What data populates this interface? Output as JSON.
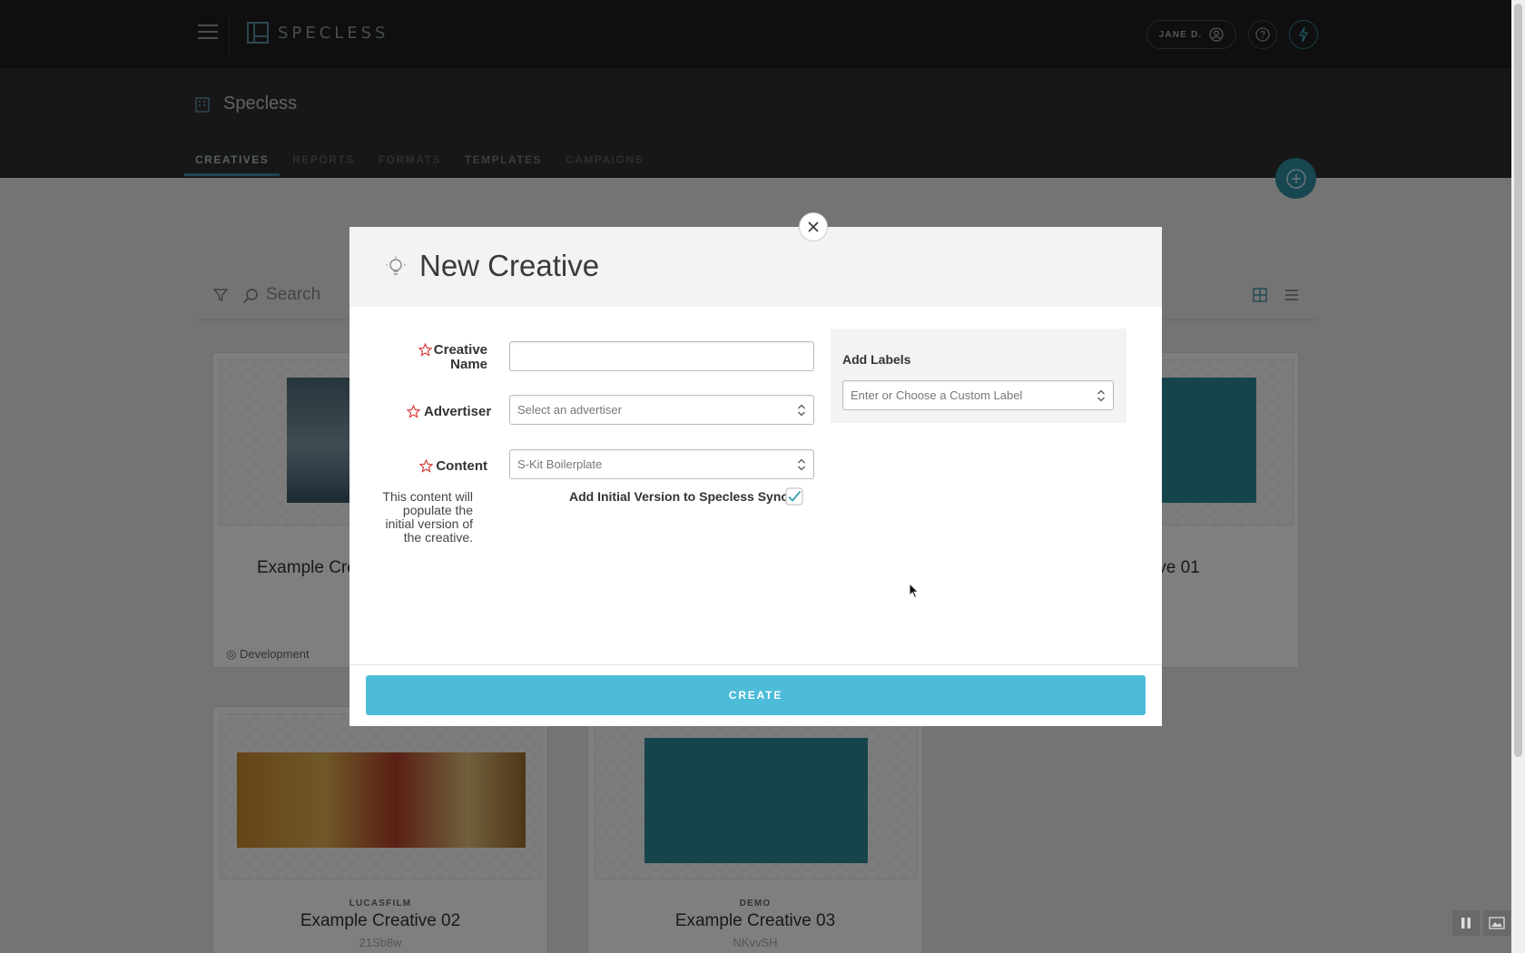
{
  "app": {
    "logo_text": "SPECLESS",
    "user_label": "JANE D.",
    "org_name": "Specless",
    "tabs": [
      {
        "label": "CREATIVES"
      },
      {
        "label": "REPORTS"
      },
      {
        "label": "FORMATS"
      },
      {
        "label": "TEMPLATES"
      },
      {
        "label": "CAMPAIGNS"
      }
    ],
    "accent_color": "#2f8ea0"
  },
  "background": {
    "search_label": "Search",
    "cards": [
      {
        "title": "Example Crea",
        "status": "Development"
      },
      {
        "title": "ive 01"
      },
      {
        "advertiser": "LUCASFILM",
        "title": "Example Creative 02",
        "id": "21Sb8w"
      },
      {
        "advertiser": "DEMO",
        "title": "Example Creative 03",
        "id": "NKvvSH"
      }
    ]
  },
  "modal": {
    "title": "New Creative",
    "fields": {
      "creative_name_label": "Creative Name",
      "creative_name_value": "",
      "advertiser_label": "Advertiser",
      "advertiser_placeholder": "Select an advertiser",
      "content_label": "Content",
      "content_value": "S-Kit Boilerplate",
      "content_help": "This content will populate the initial version of the creative.",
      "sync_label": "Add Initial Version to Specless Sync",
      "sync_checked": true
    },
    "labels": {
      "title": "Add Labels",
      "placeholder": "Enter or Choose a Custom Label"
    },
    "create_label": "CREATE",
    "create_color": "#4dbcd8"
  }
}
